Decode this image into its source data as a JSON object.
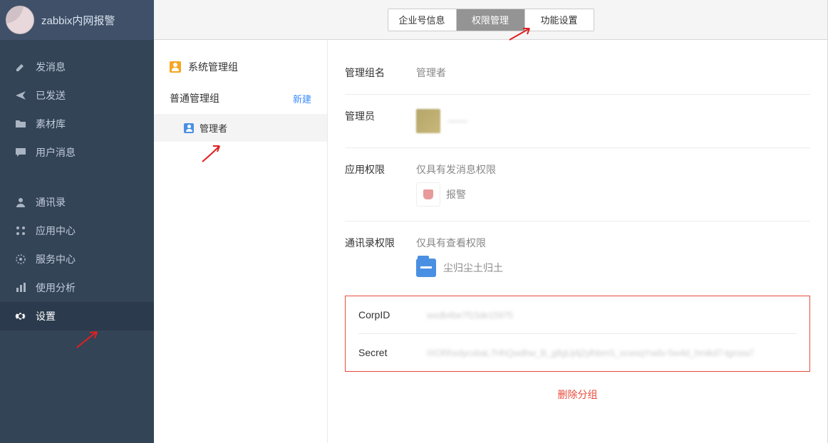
{
  "app": {
    "title": "zabbix内网报警"
  },
  "sidebar": {
    "group1": [
      {
        "label": "发消息",
        "icon": "pencil"
      },
      {
        "label": "已发送",
        "icon": "send"
      },
      {
        "label": "素材库",
        "icon": "folder"
      },
      {
        "label": "用户消息",
        "icon": "chat"
      }
    ],
    "group2": [
      {
        "label": "通讯录",
        "icon": "person"
      },
      {
        "label": "应用中心",
        "icon": "apps"
      },
      {
        "label": "服务中心",
        "icon": "dial"
      },
      {
        "label": "使用分析",
        "icon": "bars"
      },
      {
        "label": "设置",
        "icon": "gear"
      }
    ],
    "active": "设置"
  },
  "tabs": {
    "items": [
      "企业号信息",
      "权限管理",
      "功能设置"
    ],
    "active": "权限管理"
  },
  "leftPane": {
    "sysGroupTitle": "系统管理组",
    "normalGroupTitle": "普通管理组",
    "newLink": "新建",
    "selectedItem": "管理者"
  },
  "detail": {
    "groupNameLabel": "管理组名",
    "groupNameValue": "管理者",
    "adminLabel": "管理员",
    "adminName": "——",
    "appPermLabel": "应用权限",
    "appPermDesc": "仅具有发消息权限",
    "alarmLabel": "报警",
    "contactPermLabel": "通讯录权限",
    "contactPermDesc": "仅具有查看权限",
    "contactItem": "尘归尘土归土",
    "corpIdLabel": "CorpID",
    "corpIdValue": "wxdb4be7f15de15975",
    "secretLabel": "Secret",
    "secretValue": "IXORhxdycxbaL7HhQwdhw_B_g8gUj4j2ylhbmS_scwsqYwdv-5w4d_hmikd7-tgrcea7",
    "deleteLink": "删除分组"
  }
}
